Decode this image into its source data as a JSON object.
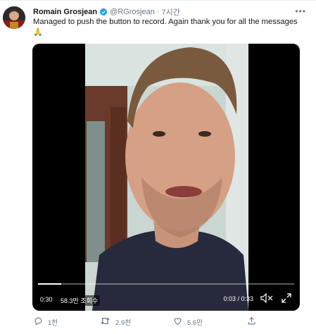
{
  "tweet": {
    "author_name": "Romain Grosjean",
    "handle": "@RGrosjean",
    "separator": "·",
    "time": "7시간",
    "text": "Managed to push the button to record. Again thank you for all the messages",
    "emoji": "🙏",
    "verified": true,
    "more_icon": "more-horizontal-icon"
  },
  "video": {
    "elapsed": "0:30",
    "views": "58.3만 조회수",
    "clock": "0:03 / 0:33",
    "progress": 0.09
  },
  "actions": {
    "reply_count": "1천",
    "retweet_count": "2.9천",
    "like_count": "5.6만",
    "icons": [
      "reply-icon",
      "retweet-icon",
      "like-icon",
      "share-icon"
    ]
  },
  "colors": {
    "text": "#14171a",
    "secondary": "#657786",
    "verified_blue": "#1da1f2",
    "video_bg": "#000000"
  }
}
